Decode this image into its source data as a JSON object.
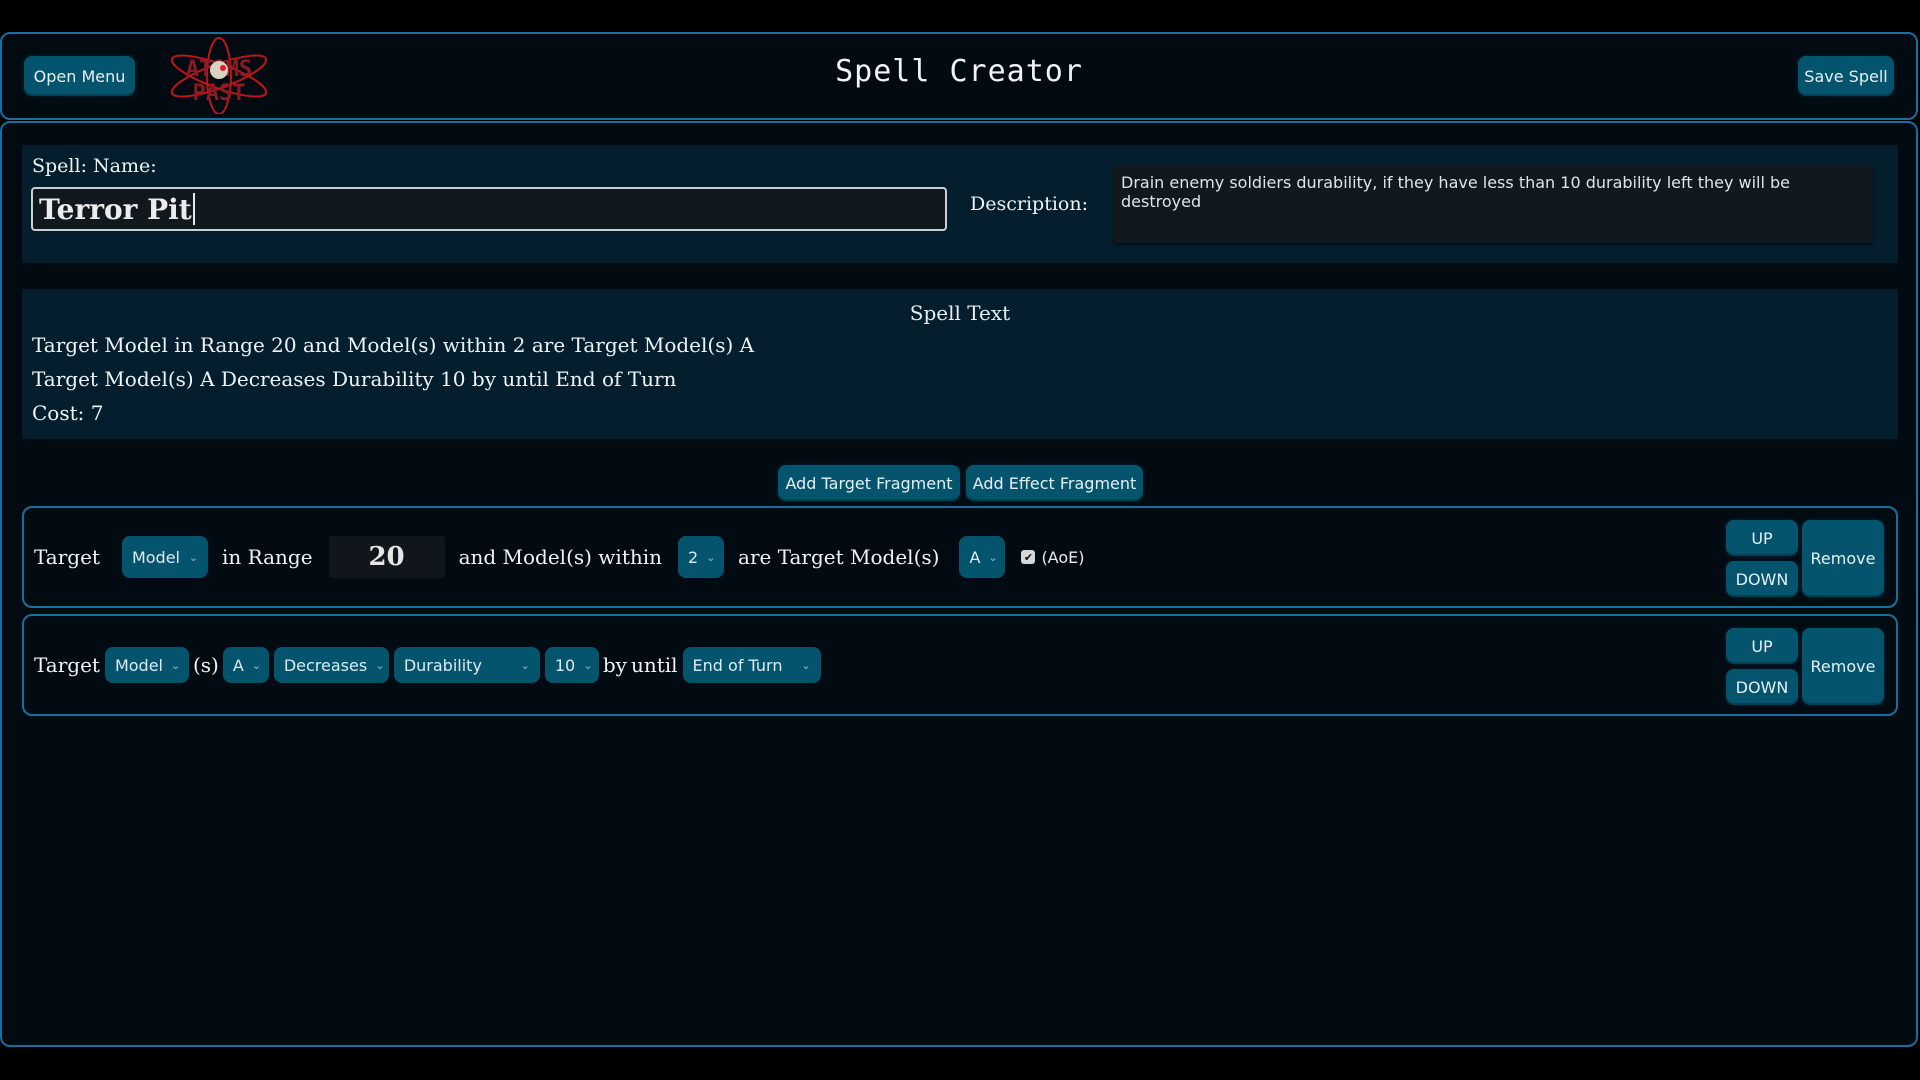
{
  "header": {
    "open_menu_label": "Open Menu",
    "logo_icon": "atoms-past-skull-logo",
    "title": "Spell Creator",
    "save_label": "Save Spell"
  },
  "colors": {
    "accent": "#04546e",
    "frame_border": "#1a6e9e",
    "panel_bg": "#041e2e",
    "page_bg": "#020b12"
  },
  "spell": {
    "name_label": "Spell: Name:",
    "name_value": "Terror Pit",
    "description_label": "Description:",
    "description_value": "Drain enemy soldiers durability, if they have less than 10 durability left they will be destroyed"
  },
  "spell_text": {
    "title": "Spell Text",
    "lines": [
      "Target Model in Range 20 and Model(s) within 2 are Target Model(s) A",
      "Target Model(s) A Decreases Durability 10 by until End of Turn",
      "Cost: 7"
    ]
  },
  "actions": {
    "add_target_label": "Add Target Fragment",
    "add_effect_label": "Add Effect Fragment"
  },
  "fragments": [
    {
      "words": [
        "Target",
        "in Range",
        "and Model(s) within",
        "are Target Model(s)"
      ],
      "unit_select": "Model",
      "range_value": "20",
      "within_select": "2",
      "group_select": "A",
      "aoe_checked": true,
      "aoe_label": "(AoE)",
      "up_label": "UP",
      "down_label": "DOWN",
      "remove_label": "Remove"
    },
    {
      "words": [
        "Target",
        "(s)",
        "by",
        "until"
      ],
      "unit_select": "Model",
      "group_select": "A",
      "operation_select": "Decreases",
      "stat_select": "Durability",
      "amount_select": "10",
      "duration_select": "End of Turn",
      "up_label": "UP",
      "down_label": "DOWN",
      "remove_label": "Remove"
    }
  ],
  "chevron_icon": "⌄",
  "check_icon": "✔"
}
